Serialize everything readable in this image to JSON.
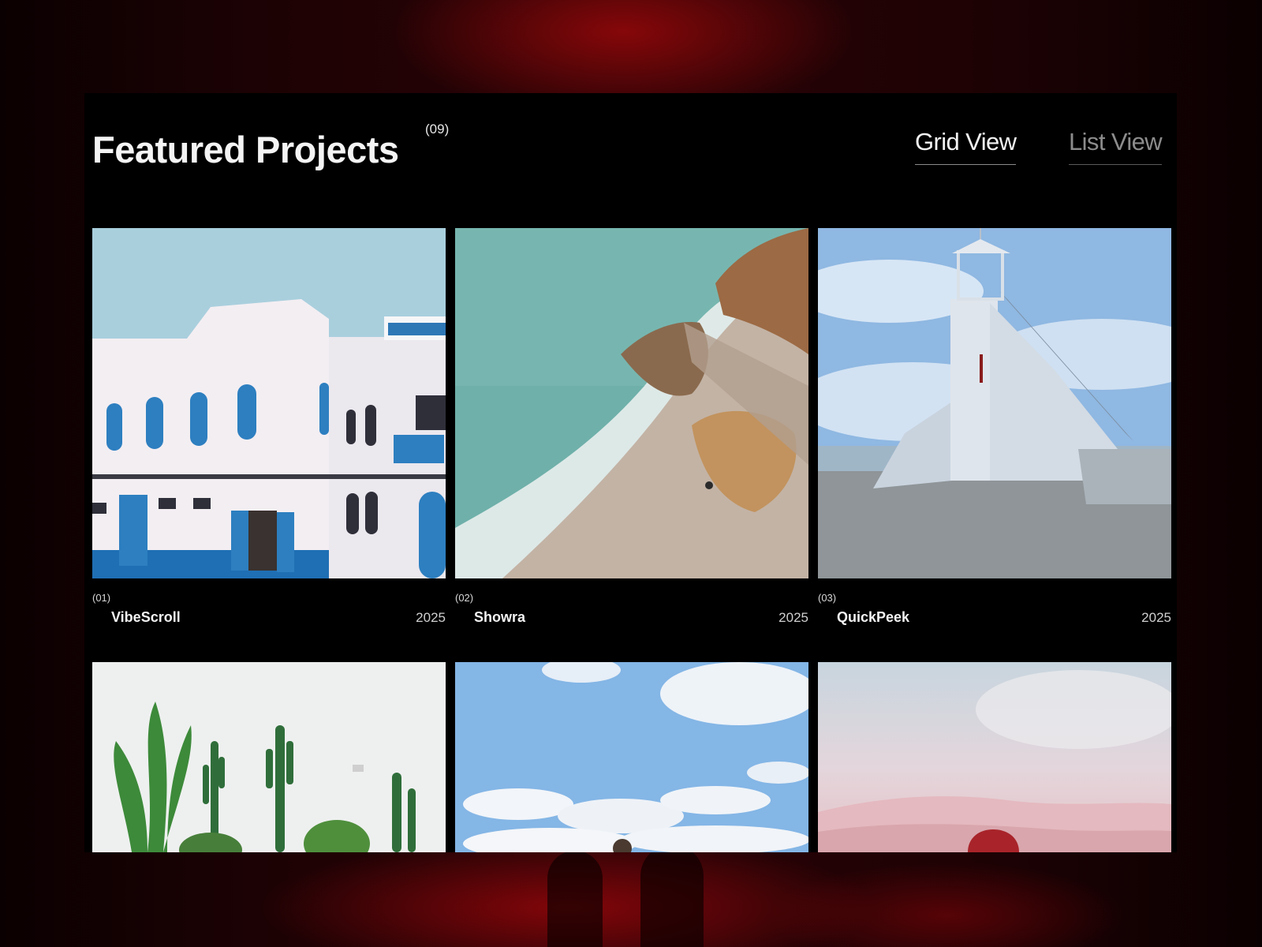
{
  "header": {
    "title": "Featured Projects",
    "count": "(09)",
    "views": {
      "grid_label": "Grid View",
      "list_label": "List View",
      "active": "Grid View"
    }
  },
  "projects": [
    {
      "number": "(01)",
      "name": "VibeScroll",
      "year": "2025",
      "image": "white-blue-moroccan-building"
    },
    {
      "number": "(02)",
      "name": "Showra",
      "year": "2025",
      "image": "aerial-beach-coastline"
    },
    {
      "number": "(03)",
      "name": "QuickPeek",
      "year": "2025",
      "image": "white-lighthouse-staircase"
    },
    {
      "image": "cacti-white-wall"
    },
    {
      "image": "blue-sky-clouds"
    },
    {
      "image": "pink-sky-hills"
    }
  ],
  "colors": {
    "background": "#000000",
    "backdrop_accent": "#8c0508",
    "text_primary": "#f4f4f4",
    "text_muted": "#8c8c8c"
  }
}
